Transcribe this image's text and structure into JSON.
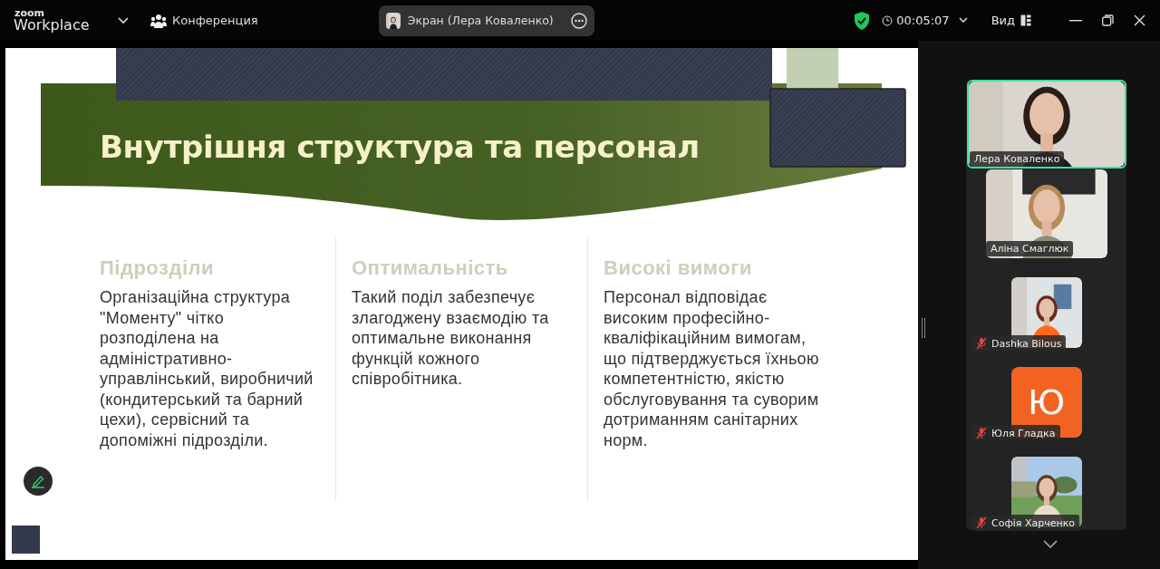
{
  "app": {
    "logo_top": "zoom",
    "logo_bottom": "Workplace",
    "meeting_label": "Конференция",
    "share_label": "Экран (Лера Коваленко)",
    "timer": "00:05:07",
    "view_label": "Вид",
    "secure": true
  },
  "slide": {
    "title": "Внутрішня структура та персонал",
    "columns": [
      {
        "heading": "Підрозділи",
        "text": "Організаційна структура \"Моменту\" чітко розподілена на адміністративно-управлінський, виробничий (кондитерський та барний цехи), сервісний та допоміжні підрозділи."
      },
      {
        "heading": "Оптимальність",
        "text": "Такий поділ забезпечує злагоджену взаємодію та оптимальне виконання функцій кожного співробітника."
      },
      {
        "heading": "Високі вимоги",
        "text": "Персонал відповідає високим професійно-кваліфікаційним вимогам, що підтверджується їхньою компетентністю, якістю обслуговування та суворим дотриманням санітарних норм."
      }
    ]
  },
  "participants": [
    {
      "name": "Лера Коваленко",
      "kind": "video",
      "muted": false,
      "speaking": true
    },
    {
      "name": "Аліна Смаглюк",
      "kind": "video",
      "muted": false,
      "speaking": false
    },
    {
      "name": "Dashka Bilous",
      "kind": "video",
      "muted": true,
      "speaking": false
    },
    {
      "name": "Юля Гладка",
      "kind": "avatar",
      "initial": "Ю",
      "color": "#f26322",
      "muted": true,
      "speaking": false
    },
    {
      "name": "Софія Харченко",
      "kind": "video",
      "muted": true,
      "speaking": false
    }
  ]
}
